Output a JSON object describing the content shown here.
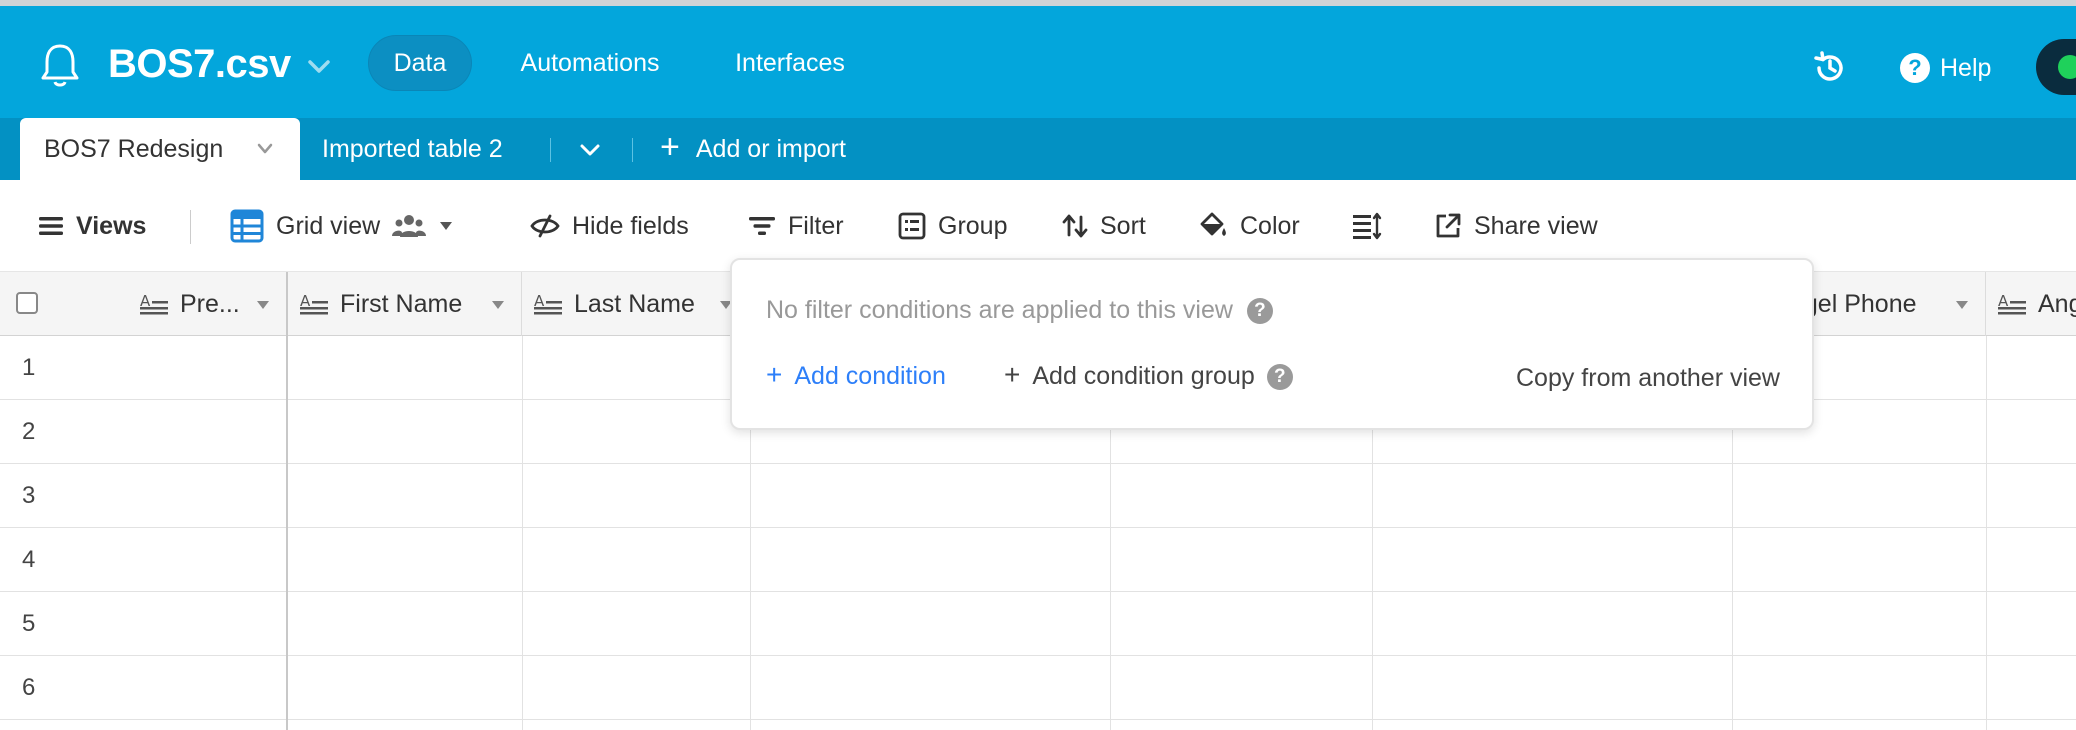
{
  "header": {
    "base_name": "BOS7.csv",
    "nav": [
      "Data",
      "Automations",
      "Interfaces"
    ],
    "help_label": "Help",
    "accent_color": "#03a6dc"
  },
  "tabs": {
    "active": "BOS7 Redesign",
    "other": "Imported table 2",
    "add_label": "Add or import"
  },
  "toolbar": {
    "views": "Views",
    "grid_view": "Grid view",
    "hide_fields": "Hide fields",
    "filter": "Filter",
    "group": "Group",
    "sort": "Sort",
    "color": "Color",
    "share_view": "Share view"
  },
  "grid": {
    "columns": [
      "Pre...",
      "First Name",
      "Last Name",
      "ngel Phone",
      "Ang"
    ],
    "row_numbers": [
      "1",
      "2",
      "3",
      "4",
      "5",
      "6"
    ]
  },
  "filter_popover": {
    "empty_message": "No filter conditions are applied to this view",
    "add_condition": "Add condition",
    "add_condition_group": "Add condition group",
    "copy_from_view": "Copy from another view",
    "link_color": "#2d7ff9"
  }
}
